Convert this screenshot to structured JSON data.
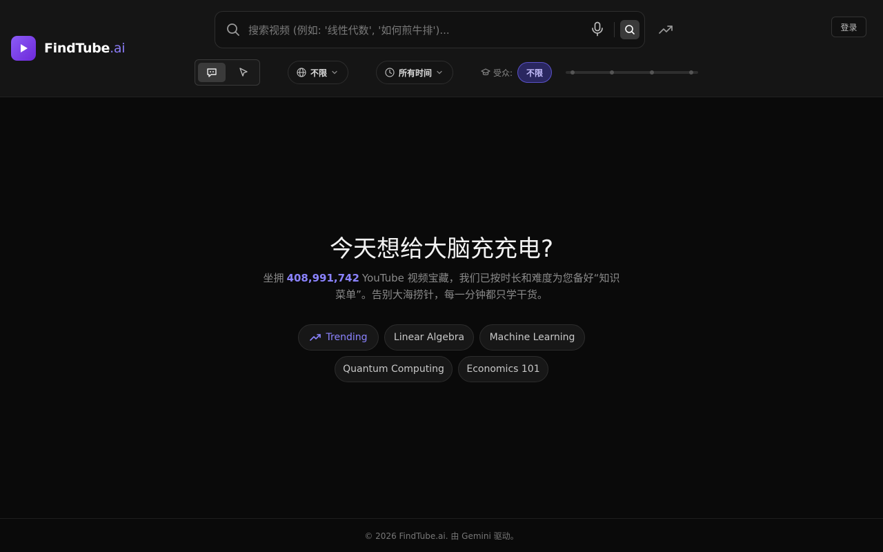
{
  "brand": {
    "name": "FindTube",
    "suffix": ".ai",
    "accent": "#8b5cf6"
  },
  "search": {
    "placeholder": "搜索视频 (例如: '线性代数', '如何煎牛排')...",
    "value": ""
  },
  "header": {
    "login_label": "登录"
  },
  "filters": {
    "language": {
      "selected": "不限",
      "icon": "globe-icon"
    },
    "time": {
      "selected": "所有时间",
      "icon": "clock-icon"
    },
    "audience": {
      "label": "受众:",
      "selected": "不限",
      "icon": "graduation-cap-icon"
    }
  },
  "hero": {
    "title": "今天想给大脑充充电?",
    "sub_prefix": "坐拥",
    "video_count": "408,991,742",
    "sub_suffix": "YouTube 视频宝藏，我们已按时长和难度为您备好“知识菜单”。告别大海捞针，每一分钟都只学干货。"
  },
  "chips": [
    {
      "label": "Trending",
      "icon": "trending-up-icon"
    },
    {
      "label": "Linear Algebra"
    },
    {
      "label": "Machine Learning"
    },
    {
      "label": "Quantum Computing"
    },
    {
      "label": "Economics 101"
    }
  ],
  "footer": {
    "text": "© 2026 FindTube.ai. 由 Gemini 驱动。"
  }
}
